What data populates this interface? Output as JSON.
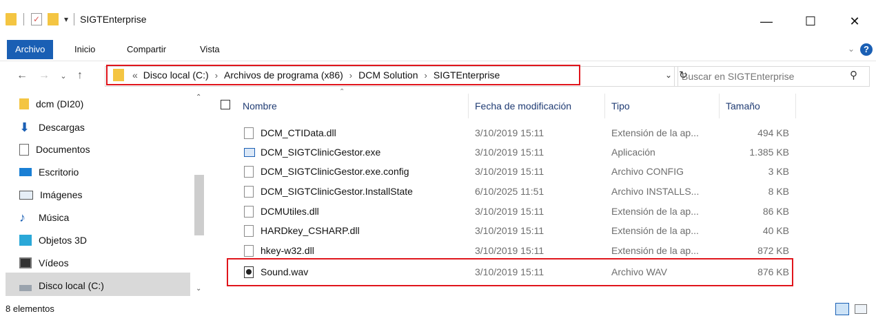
{
  "window": {
    "title": "SIGTEnterprise",
    "minimize": "—",
    "maximize": "☐",
    "close": "✕"
  },
  "ribbon": {
    "tabs": [
      "Archivo",
      "Inicio",
      "Compartir",
      "Vista"
    ],
    "help": "?"
  },
  "address": {
    "overflow": "«",
    "crumbs": [
      "Disco local (C:)",
      "Archivos de programa (x86)",
      "DCM Solution",
      "SIGTEnterprise"
    ],
    "separator": "›"
  },
  "search": {
    "placeholder": "Buscar en SIGTEnterprise"
  },
  "nav": {
    "items": [
      {
        "label": "dcm (DI20)",
        "icon": "user-folder-icon"
      },
      {
        "label": "Descargas",
        "icon": "download-icon"
      },
      {
        "label": "Documentos",
        "icon": "documents-icon"
      },
      {
        "label": "Escritorio",
        "icon": "desktop-icon"
      },
      {
        "label": "Imágenes",
        "icon": "pictures-icon"
      },
      {
        "label": "Música",
        "icon": "music-icon"
      },
      {
        "label": "Objetos 3D",
        "icon": "objects-3d-icon"
      },
      {
        "label": "Vídeos",
        "icon": "videos-icon"
      },
      {
        "label": "Disco local (C:)",
        "icon": "local-disk-icon"
      }
    ],
    "selected": "Disco local (C:)"
  },
  "columns": {
    "name": "Nombre",
    "date": "Fecha de modificación",
    "type": "Tipo",
    "size": "Tamaño"
  },
  "files": [
    {
      "name": "DCM_CTIData.dll",
      "date": "3/10/2019 15:11",
      "type": "Extensión de la ap...",
      "size": "494 KB",
      "icon": "dll-icon"
    },
    {
      "name": "DCM_SIGTClinicGestor.exe",
      "date": "3/10/2019 15:11",
      "type": "Aplicación",
      "size": "1.385 KB",
      "icon": "exe-icon"
    },
    {
      "name": "DCM_SIGTClinicGestor.exe.config",
      "date": "3/10/2019 15:11",
      "type": "Archivo CONFIG",
      "size": "3 KB",
      "icon": "file-icon"
    },
    {
      "name": "DCM_SIGTClinicGestor.InstallState",
      "date": "6/10/2025 11:51",
      "type": "Archivo INSTALLS...",
      "size": "8 KB",
      "icon": "file-icon"
    },
    {
      "name": "DCMUtiles.dll",
      "date": "3/10/2019 15:11",
      "type": "Extensión de la ap...",
      "size": "86 KB",
      "icon": "dll-icon"
    },
    {
      "name": "HARDkey_CSHARP.dll",
      "date": "3/10/2019 15:11",
      "type": "Extensión de la ap...",
      "size": "40 KB",
      "icon": "dll-icon"
    },
    {
      "name": "hkey-w32.dll",
      "date": "3/10/2019 15:11",
      "type": "Extensión de la ap...",
      "size": "872 KB",
      "icon": "dll-icon"
    },
    {
      "name": "Sound.wav",
      "date": "3/10/2019 15:11",
      "type": "Archivo WAV",
      "size": "876 KB",
      "icon": "wav-icon"
    }
  ],
  "status": {
    "count": "8 elementos"
  },
  "colors": {
    "accent": "#1a5fb4",
    "highlight": "#e0141b",
    "folder": "#f4c542"
  }
}
